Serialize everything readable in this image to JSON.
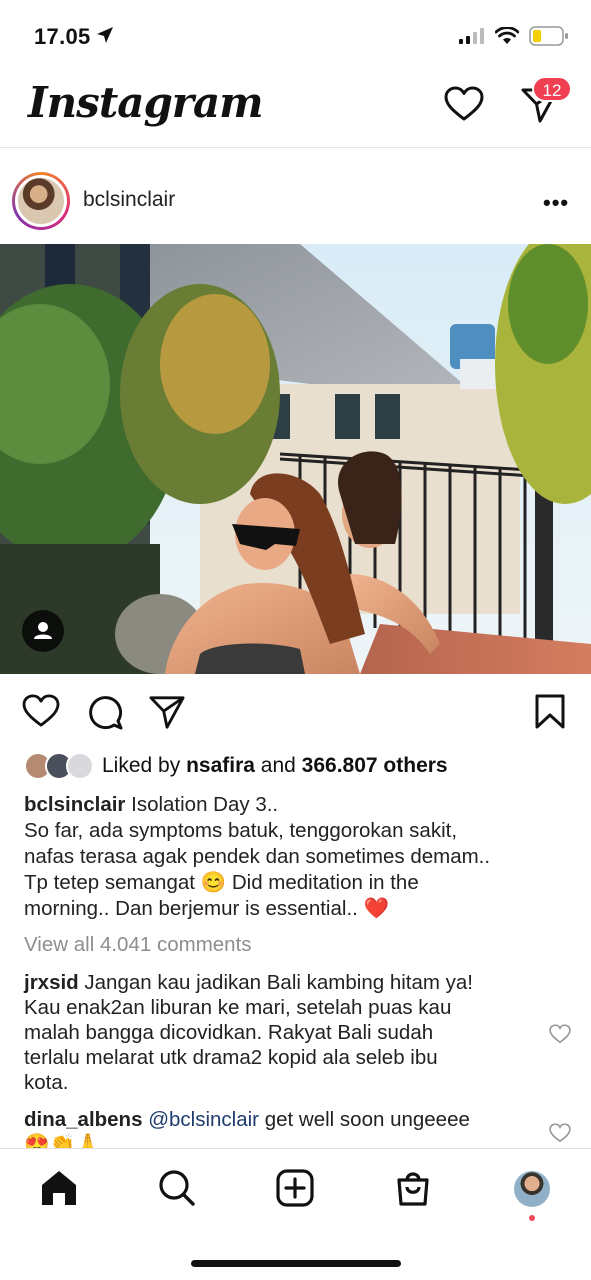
{
  "status": {
    "time": "17.05",
    "icons": [
      "location-arrow-icon",
      "signal-icon",
      "wifi-icon",
      "battery-icon"
    ],
    "battery_level": 0.3,
    "battery_color": "#f4d000"
  },
  "header": {
    "logo": "Instagram",
    "dm_badge": "12",
    "badge_color": "#ef3f50"
  },
  "post": {
    "username": "bclsinclair",
    "more": "•••",
    "liked_by_prefix": "Liked by",
    "liked_by_user": "nsafira",
    "liked_and": "and",
    "liked_others": "366.807 others",
    "caption_user": "bclsinclair",
    "caption_lines": [
      " Isolation Day 3..",
      "So far, ada symptoms batuk, tenggorokan sakit,",
      "nafas terasa agak pendek dan sometimes demam..",
      "Tp tetep semangat 😊 Did meditation in the",
      "morning.. Dan berjemur is essential.. ❤️"
    ],
    "view_all": "View all 4.041 comments"
  },
  "comments": [
    {
      "user": "jrxsid",
      "lines": [
        " Jangan kau jadikan Bali kambing hitam ya!",
        "Kau enak2an liburan ke mari, setelah puas kau",
        "malah bangga dicovidkan. Rakyat Bali sudah",
        "terlalu melarat utk drama2 kopid ala seleb ibu",
        "kota."
      ]
    },
    {
      "user": "dina_albens",
      "mention": " @bclsinclair",
      "text": " get well soon ungeeee",
      "emoji": "😍👏🙏"
    }
  ],
  "nav": [
    "home-icon",
    "search-icon",
    "new-post-icon",
    "shop-icon",
    "profile-avatar"
  ]
}
